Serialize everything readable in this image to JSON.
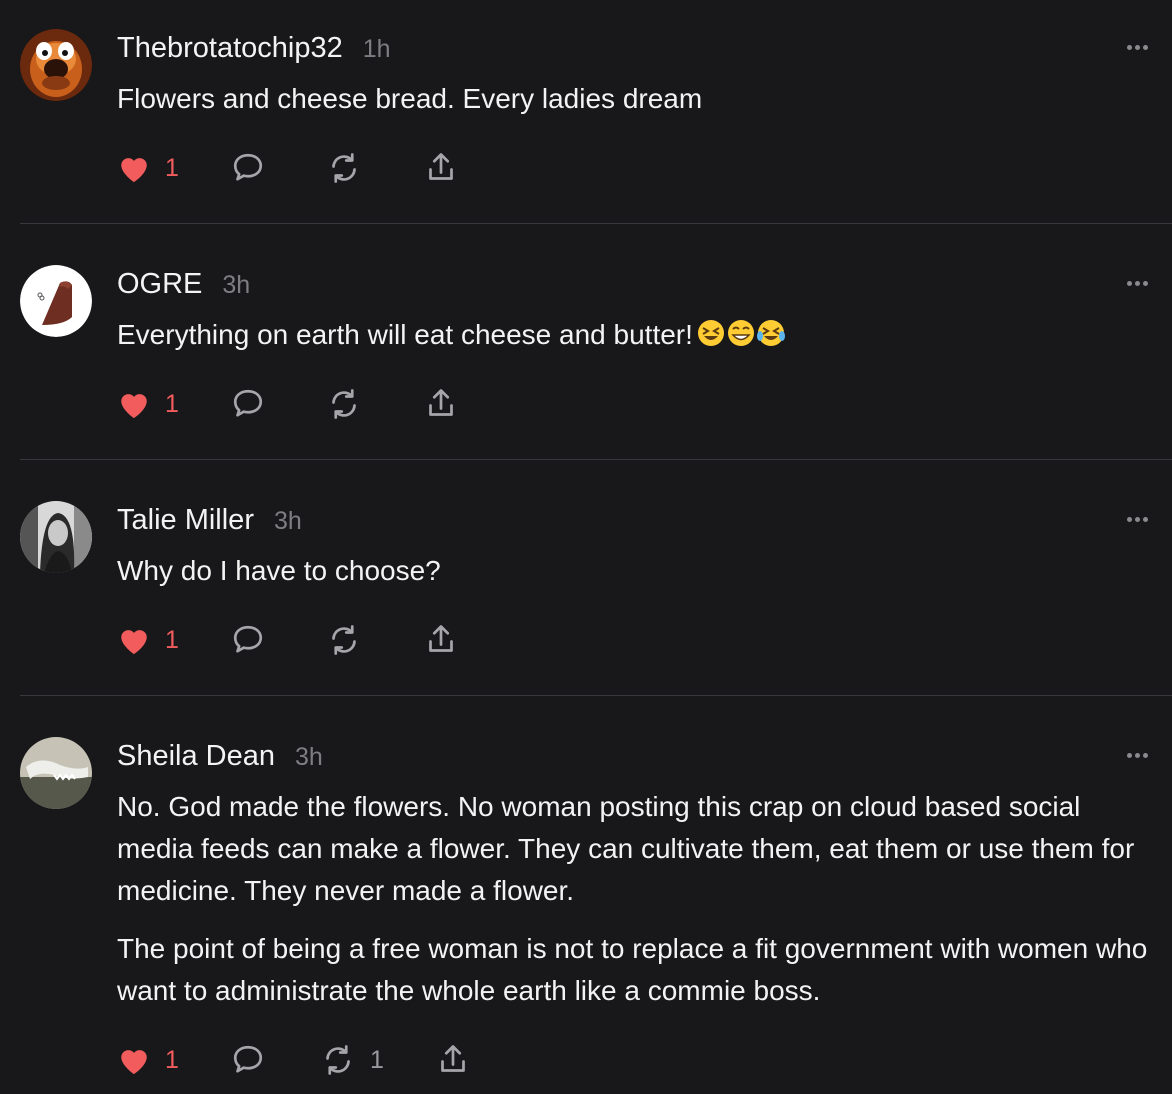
{
  "posts": [
    {
      "username": "Thebrotatochip32",
      "time": "1h",
      "paragraphs": [
        "Flowers and cheese bread. Every ladies dream"
      ],
      "likes": "1",
      "reposts": "",
      "avatar": "cartoon-dog-avatar"
    },
    {
      "username": "OGRE",
      "time": "3h",
      "paragraphs": [
        "Everything on earth will eat cheese and butter!"
      ],
      "emojis": [
        "laughing-emoji",
        "grinning-emoji",
        "tears-of-joy-emoji"
      ],
      "likes": "1",
      "reposts": "",
      "avatar": "bread-loaf-avatar"
    },
    {
      "username": "Talie Miller",
      "time": "3h",
      "paragraphs": [
        "Why do I have to choose?"
      ],
      "likes": "1",
      "reposts": "",
      "avatar": "woman-portrait-avatar"
    },
    {
      "username": "Sheila Dean",
      "time": "3h",
      "paragraphs": [
        "No. God made the flowers. No woman posting this crap on cloud based social media feeds can make a flower. They can cultivate them, eat them or use them for medicine. They never made a flower.",
        "The point of being a free woman is not to replace a fit government with women who want to administrate the whole earth like a commie boss."
      ],
      "likes": "1",
      "reposts": "1",
      "avatar": "jawbone-avatar"
    }
  ],
  "colors": {
    "background": "#18181b",
    "text": "#f3f3f3",
    "muted": "#7d7d82",
    "like_red": "#f25c5c",
    "divider": "#38383c"
  }
}
